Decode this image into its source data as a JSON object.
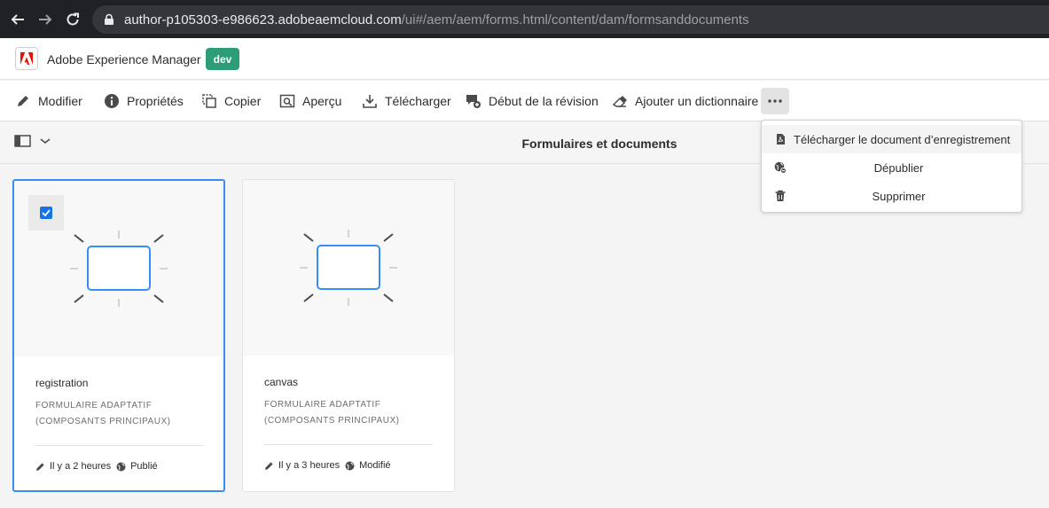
{
  "browser": {
    "url_host": "author-p105303-e986623.adobeaemcloud.com",
    "url_path": "/ui#/aem/aem/forms.html/content/dam/formsanddocuments"
  },
  "header": {
    "app_title": "Adobe Experience Manager",
    "env_badge": "dev",
    "badge_color": "#2d9d78"
  },
  "actions": [
    {
      "label": "Modifier",
      "icon": "pencil-icon"
    },
    {
      "label": "Propriétés",
      "icon": "info-icon"
    },
    {
      "label": "Copier",
      "icon": "copy-icon"
    },
    {
      "label": "Aperçu",
      "icon": "preview-icon"
    },
    {
      "label": "Télécharger",
      "icon": "download-icon"
    },
    {
      "label": "Début de la révision",
      "icon": "review-icon"
    },
    {
      "label": "Ajouter un dictionnaire",
      "icon": "eraser-icon"
    }
  ],
  "title_bar": {
    "title": "Formulaires et documents"
  },
  "dropdown": {
    "items": [
      {
        "label": "Télécharger le document d’enregistrement",
        "icon": "pdf-document-icon"
      },
      {
        "label": "Dépublier",
        "icon": "unpublish-globe-icon"
      },
      {
        "label": "Supprimer",
        "icon": "trash-icon"
      }
    ]
  },
  "cards": [
    {
      "name": "registration",
      "type_line1": "FORMULAIRE ADAPTATIF",
      "type_line2": "(COMPOSANTS PRINCIPAUX)",
      "modified": "Il y a 2 heures",
      "status": "Publié",
      "selected": true
    },
    {
      "name": "canvas",
      "type_line1": "FORMULAIRE ADAPTATIF",
      "type_line2": "(COMPOSANTS PRINCIPAUX)",
      "modified": "Il y a 3 heures",
      "status": "Modifié",
      "selected": false
    }
  ],
  "colors": {
    "accent": "#1473e6",
    "selection_border": "#378ef0"
  }
}
